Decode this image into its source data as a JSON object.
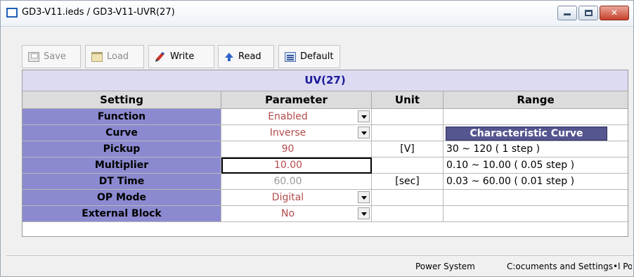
{
  "window": {
    "title": "GD3-V11.ieds / GD3-V11-UVR(27)",
    "controls": {
      "minimize": "–",
      "maximize": "□",
      "close": "✕"
    }
  },
  "toolbar": {
    "save_label": "Save",
    "load_label": "Load",
    "write_label": "Write",
    "read_label": "Read",
    "default_label": "Default"
  },
  "grid": {
    "title": "UV(27)",
    "headers": {
      "setting": "Setting",
      "parameter": "Parameter",
      "unit": "Unit",
      "range": "Range"
    },
    "characteristic_curve_label": "Characteristic Curve",
    "rows": [
      {
        "setting": "Function",
        "parameter": "Enabled",
        "unit": "",
        "range": ""
      },
      {
        "setting": "Curve",
        "parameter": "Inverse",
        "unit": "",
        "range": ""
      },
      {
        "setting": "Pickup",
        "parameter": "90",
        "unit": "[V]",
        "range": "30 ~ 120 ( 1 step )"
      },
      {
        "setting": "Multiplier",
        "parameter": "10.00",
        "unit": "",
        "range": "0.10 ~ 10.00 ( 0.05 step )"
      },
      {
        "setting": "DT Time",
        "parameter": "60.00",
        "unit": "[sec]",
        "range": "0.03 ~ 60.00 ( 0.01 step )"
      },
      {
        "setting": "OP Mode",
        "parameter": "Digital",
        "unit": "",
        "range": ""
      },
      {
        "setting": "External Block",
        "parameter": "No",
        "unit": "",
        "range": ""
      }
    ]
  },
  "statusbar": {
    "system": "Power System",
    "path": "C:ocuments and Settings•l Po"
  },
  "colors": {
    "setting_cell": "#8b8ad0",
    "title_band": "#dcdbf2",
    "title_text": "#1a1a9a",
    "param_text": "#b44b4b",
    "char_curve_bg": "#55558f"
  }
}
